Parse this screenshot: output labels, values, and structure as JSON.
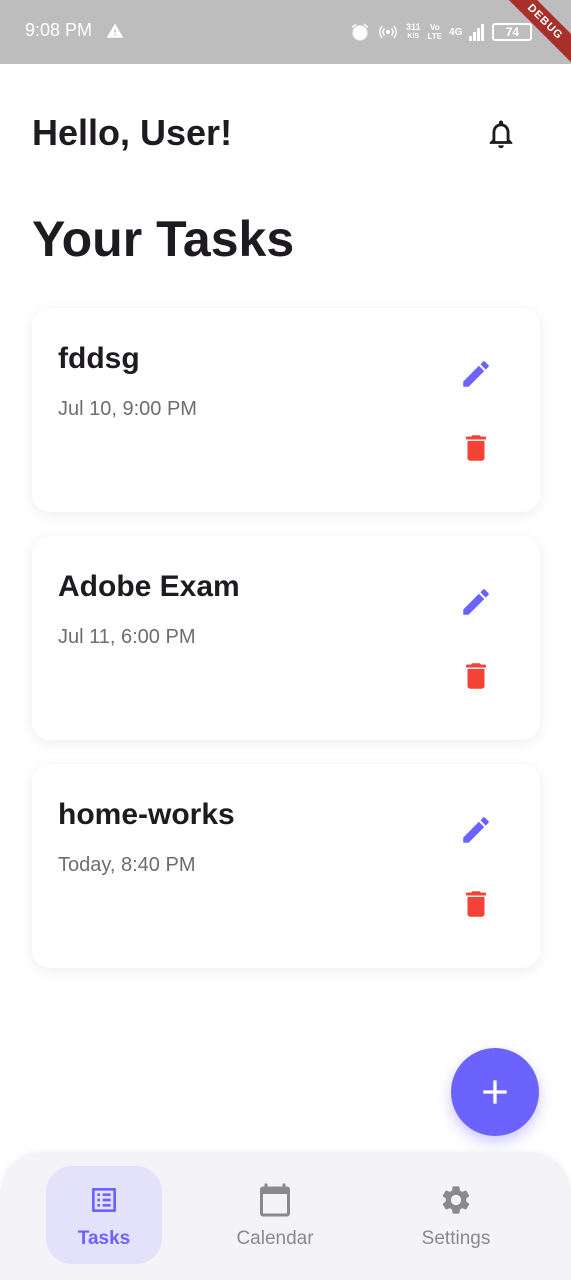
{
  "status_bar": {
    "time": "9:08 PM",
    "speed_value": "311",
    "speed_unit": "K/S",
    "volte_top": "Vo",
    "volte_bottom": "LTE",
    "network": "4G",
    "battery": "74",
    "debug_label": "DEBUG"
  },
  "header": {
    "greeting": "Hello, User!",
    "section_title": "Your Tasks"
  },
  "tasks": [
    {
      "title": "fddsg",
      "time": "Jul 10, 9:00 PM"
    },
    {
      "title": "Adobe Exam",
      "time": "Jul 11, 6:00 PM"
    },
    {
      "title": "home-works",
      "time": "Today, 8:40 PM"
    }
  ],
  "icons": {
    "notification": "bell-icon",
    "edit": "pencil-icon",
    "delete": "trash-icon",
    "add": "plus-icon"
  },
  "nav": {
    "items": [
      {
        "label": "Tasks",
        "icon": "list-icon",
        "active": true
      },
      {
        "label": "Calendar",
        "icon": "calendar-icon",
        "active": false
      },
      {
        "label": "Settings",
        "icon": "gear-icon",
        "active": false
      }
    ]
  },
  "colors": {
    "accent": "#6c63ff",
    "delete": "#f44336",
    "nav_active_bg": "#e4e1fa",
    "status_bar": "#bdbdbd"
  }
}
